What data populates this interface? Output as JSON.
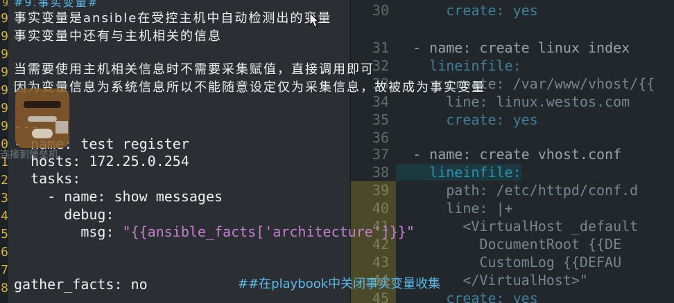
{
  "colors": {
    "line_number": "#d7b33a",
    "comment": "#5bbbe8",
    "string": "#c57fd0",
    "text": "#f0f0f0",
    "background": "#2b2f33"
  },
  "foreground": {
    "line_numbers": [
      "9",
      "9",
      "9",
      "9",
      "9",
      "9",
      "9",
      "",
      "",
      "9",
      "0",
      "1",
      "2",
      "3",
      "4",
      "5",
      "6",
      "7",
      "8",
      "9",
      "0",
      "1"
    ],
    "lines": {
      "l0": "#9.事实变量#",
      "l1": "事实变量是ansible在受控主机中自动检测出的变量",
      "l2": "事实变量中还有与主机相关的信息",
      "l3": "当需要使用主机相关信息时不需要采集赋值，直接调用即可",
      "l4": "因为变量信息为系统信息所以不能随意设定仅为采集信息，故被成为事实变量",
      "l5": "---",
      "l6": "- name: test register",
      "l7": "  hosts: 172.25.0.254",
      "l8": "  tasks:",
      "l9": "    - name: show messages",
      "l10": "      debug:",
      "l11_key": "        msg: ",
      "l11_value": "\"{{ansible_facts['architecture']}}\"",
      "l12": "gather_facts: no",
      "l12_comment": "##在playbook中关闭事实变量收集"
    }
  },
  "background_editor": {
    "lines": [
      {
        "num": "30",
        "text": "      create: yes"
      },
      {
        "num": "31",
        "text": "  - name: create linux index"
      },
      {
        "num": "32",
        "text": "    lineinfile:"
      },
      {
        "num": "33",
        "text": "      create: /var/www/vhost/{{"
      },
      {
        "num": "34",
        "text": "      line: linux.westos.com"
      },
      {
        "num": "35",
        "text": "      create: yes"
      },
      {
        "num": "36",
        "text": ""
      },
      {
        "num": "37",
        "text": "  - name: create vhost.conf"
      },
      {
        "num": "38",
        "text": "    lineinfile:"
      },
      {
        "num": "39",
        "text": "      path: /etc/httpd/conf.d"
      },
      {
        "num": "40",
        "text": "      line: |+"
      },
      {
        "num": "41",
        "text": "        <VirtualHost _default"
      },
      {
        "num": "42",
        "text": "          DocumentRoot {{DE"
      },
      {
        "num": "43",
        "text": "          CustomLog {{DEFAU"
      },
      {
        "num": "44",
        "text": "        </VirtualHost>\""
      },
      {
        "num": "45",
        "text": "      create: yes"
      }
    ]
  },
  "desktop": {
    "shortcut_label": "连接到堡垒机"
  }
}
